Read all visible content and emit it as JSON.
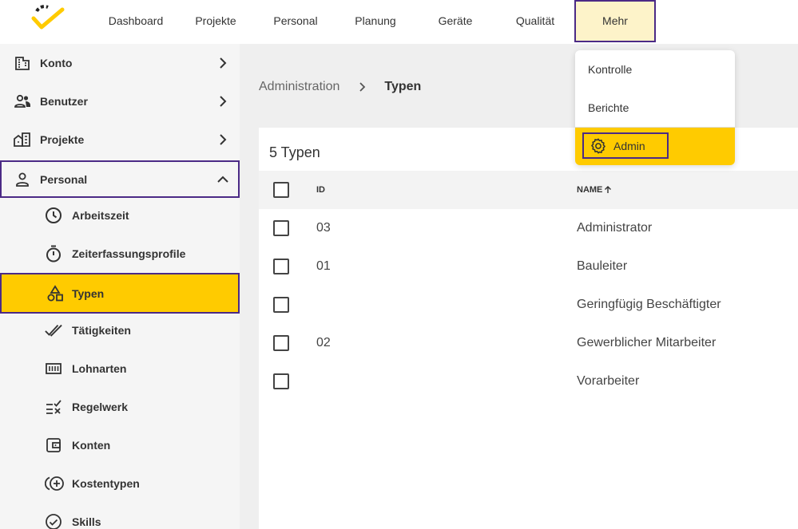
{
  "nav": {
    "items": [
      {
        "label": "Dashboard"
      },
      {
        "label": "Projekte"
      },
      {
        "label": "Personal"
      },
      {
        "label": "Planung"
      },
      {
        "label": "Geräte"
      },
      {
        "label": "Qualität"
      },
      {
        "label": "Mehr"
      }
    ]
  },
  "menu": {
    "items": [
      {
        "label": "Kontrolle"
      },
      {
        "label": "Berichte"
      },
      {
        "label": "Admin",
        "icon": "gear-icon"
      }
    ]
  },
  "sidebar": {
    "items": [
      {
        "label": "Konto",
        "icon": "building-icon"
      },
      {
        "label": "Benutzer",
        "icon": "users-icon"
      },
      {
        "label": "Projekte",
        "icon": "city-icon"
      },
      {
        "label": "Personal",
        "icon": "person-icon"
      },
      {
        "label": "Arbeitszeit",
        "icon": "clock-icon"
      },
      {
        "label": "Zeiterfassungsprofile",
        "icon": "timer-icon"
      },
      {
        "label": "Typen",
        "icon": "shapes-icon"
      },
      {
        "label": "Tätigkeiten",
        "icon": "double-check-icon"
      },
      {
        "label": "Lohnarten",
        "icon": "counter-icon"
      },
      {
        "label": "Regelwerk",
        "icon": "rules-icon"
      },
      {
        "label": "Konten",
        "icon": "wallet-icon"
      },
      {
        "label": "Kostentypen",
        "icon": "cost-plus-icon"
      },
      {
        "label": "Skills",
        "icon": "check-circle-icon"
      }
    ]
  },
  "breadcrumb": {
    "parent": "Administration",
    "current": "Typen"
  },
  "table": {
    "title": "5 Typen",
    "columns": {
      "id": "ID",
      "name": "NAME"
    },
    "sort_icon": "arrow-up-icon",
    "rows": [
      {
        "id": "03",
        "name": "Administrator"
      },
      {
        "id": "01",
        "name": "Bauleiter"
      },
      {
        "id": "",
        "name": "Geringfügig Beschäftigter"
      },
      {
        "id": "02",
        "name": "Gewerblicher Mitarbeiter"
      },
      {
        "id": "",
        "name": "Vorarbeiter"
      }
    ]
  },
  "colors": {
    "accent": "#ffcb00",
    "highlight_border": "#4b2a86",
    "nav_active_bg": "#fdf3c9"
  }
}
